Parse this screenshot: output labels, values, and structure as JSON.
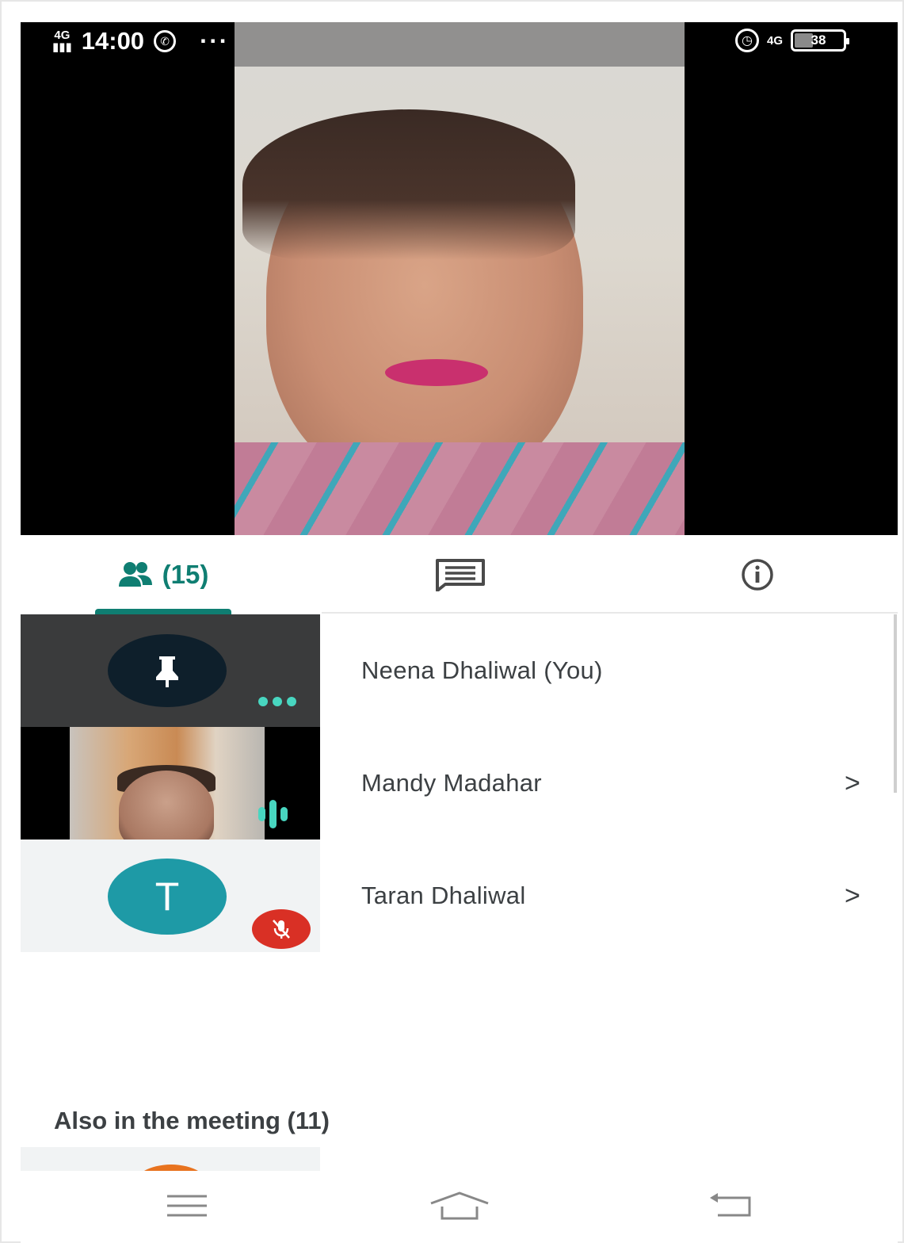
{
  "status_bar": {
    "network_left": "4G",
    "time": "14:00",
    "overflow": "···",
    "network_right": "4G",
    "battery": "38",
    "battery_level_percent": 38,
    "icons": [
      "signal-icon",
      "whatsapp-icon",
      "alarm-icon",
      "battery-icon"
    ]
  },
  "tabs": [
    {
      "icon": "people-icon",
      "label": "(15)",
      "active": true
    },
    {
      "icon": "chat-icon"
    },
    {
      "icon": "info-icon"
    }
  ],
  "participants": [
    {
      "name": "Neena Dhaliwal (You)",
      "tile": "pin-avatar",
      "indicator": "more-options-icon"
    },
    {
      "name": "Mandy Madahar",
      "tile": "camera-video",
      "indicator": "speaking-icon",
      "chevron": ">"
    },
    {
      "name": "Taran Dhaliwal",
      "tile": "initial-avatar",
      "initial": "T",
      "indicator": "mic-muted-icon",
      "chevron": ">"
    }
  ],
  "also_in_meeting": "Also in the meeting (11)",
  "nav": [
    "menu-icon",
    "home-icon",
    "back-icon"
  ],
  "colors": {
    "accent": "#0f7e72",
    "speaking": "#48d6c0",
    "muted_badge": "#d93025",
    "avatar_teal": "#1e9aa6"
  }
}
